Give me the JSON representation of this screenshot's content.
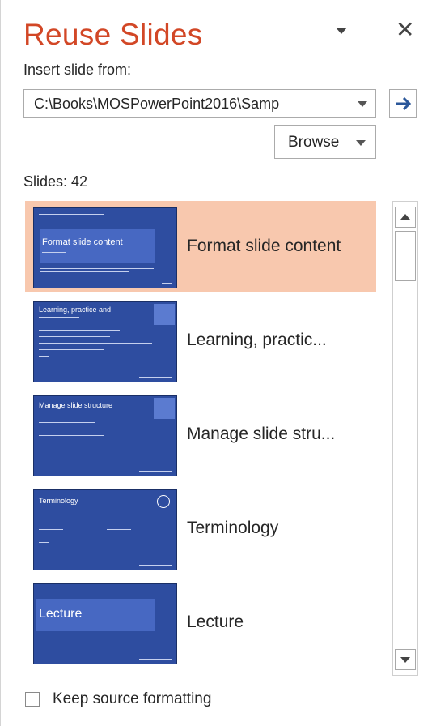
{
  "pane": {
    "title": "Reuse Slides",
    "close_glyph": "✕",
    "insert_from_label": "Insert slide from:",
    "source_path": "C:\\Books\\MOSPowerPoint2016\\Samp",
    "browse_label": "Browse",
    "slides_count_label": "Slides: 42"
  },
  "slides": [
    {
      "title": "Format slide content",
      "thumb_text": "Format slide content"
    },
    {
      "title": "Learning, practic...",
      "thumb_text": "Learning, practice and"
    },
    {
      "title": "Manage slide stru...",
      "thumb_text": "Manage slide structure"
    },
    {
      "title": "Terminology",
      "thumb_text": "Terminology"
    },
    {
      "title": "Lecture",
      "thumb_text": "Lecture"
    }
  ],
  "footer": {
    "keep_formatting_label": "Keep source formatting"
  },
  "icons": {
    "go": "arrow-right-icon",
    "close": "close-icon",
    "pane-options": "chevron-down-icon"
  },
  "colors": {
    "title": "#d24726",
    "selection": "#f8c8ae",
    "thumbnail": "#2e4da0",
    "go_arrow": "#2b579a"
  }
}
